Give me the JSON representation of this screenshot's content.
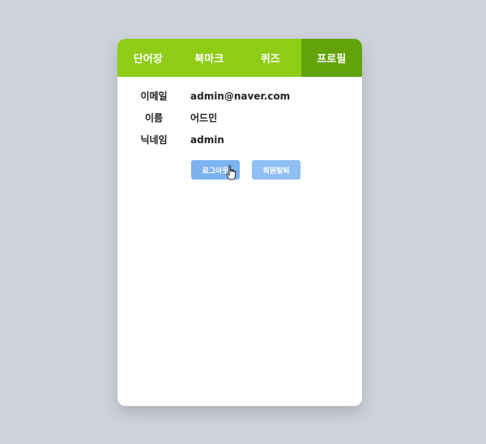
{
  "tabs": [
    {
      "label": "단어장",
      "active": false
    },
    {
      "label": "북마크",
      "active": false
    },
    {
      "label": "퀴즈",
      "active": false
    },
    {
      "label": "프로필",
      "active": true
    }
  ],
  "profile": {
    "email_label": "이메일",
    "email_value": "admin@naver.com",
    "name_label": "이름",
    "name_value": "어드민",
    "nickname_label": "닉네임",
    "nickname_value": "admin"
  },
  "buttons": {
    "logout_label": "로그아웃",
    "withdraw_label": "회원탈퇴"
  },
  "colors": {
    "tab_bar": "#8fcc16",
    "tab_active": "#62a30a",
    "button": "#8fbff3"
  }
}
